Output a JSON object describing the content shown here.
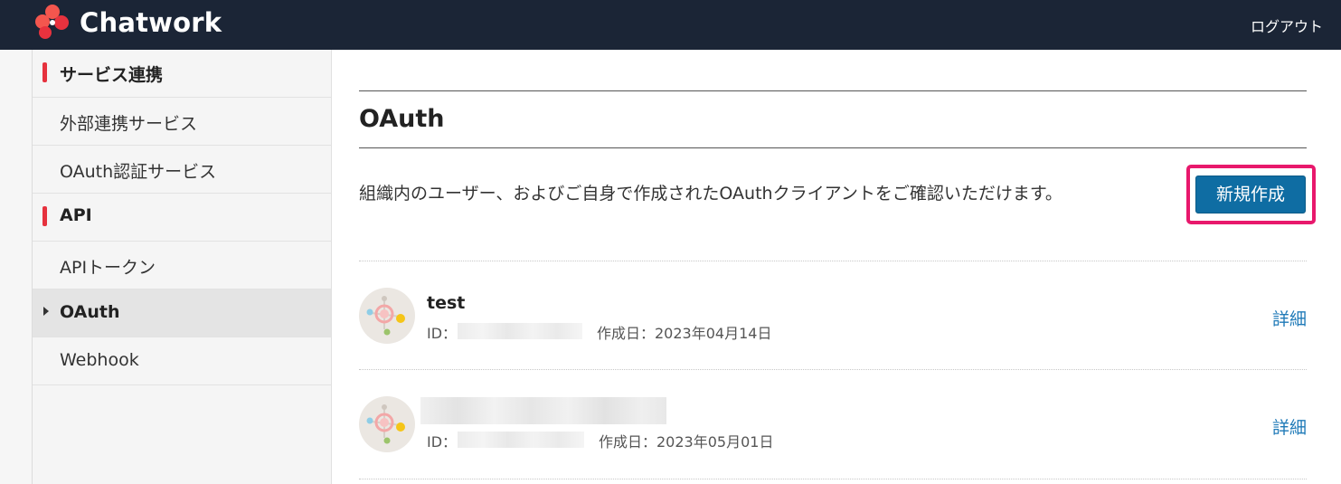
{
  "header": {
    "brand": "Chatwork",
    "logout_label": "ログアウト"
  },
  "sidebar": {
    "items": [
      {
        "label": "サービス連携",
        "type": "section"
      },
      {
        "label": "外部連携サービス",
        "type": "link"
      },
      {
        "label": "OAuth認証サービス",
        "type": "link"
      },
      {
        "label": "API",
        "type": "section"
      },
      {
        "label": "APIトークン",
        "type": "link"
      },
      {
        "label": "OAuth",
        "type": "link",
        "active": true
      },
      {
        "label": "Webhook",
        "type": "link"
      }
    ]
  },
  "main": {
    "title": "OAuth",
    "description": "組織内のユーザー、およびご自身で作成されたOAuthクライアントをご確認いただけます。",
    "new_button_label": "新規作成",
    "clients": [
      {
        "name": "test",
        "id_label": "ID：",
        "created": "作成日：2023年04月14日",
        "detail_label": "詳細"
      },
      {
        "name": "",
        "id_label": "ID：",
        "created": "作成日：2023年05月01日",
        "detail_label": "詳細"
      }
    ]
  },
  "colors": {
    "header_bg": "#1b2536",
    "accent_red": "#e6323e",
    "button_blue": "#0f6da3",
    "highlight_pink": "#e8186c",
    "link_blue": "#1f7ab8"
  },
  "icons": [
    "chatwork-logo-icon",
    "caret-right-icon",
    "client-avatar-icon"
  ]
}
